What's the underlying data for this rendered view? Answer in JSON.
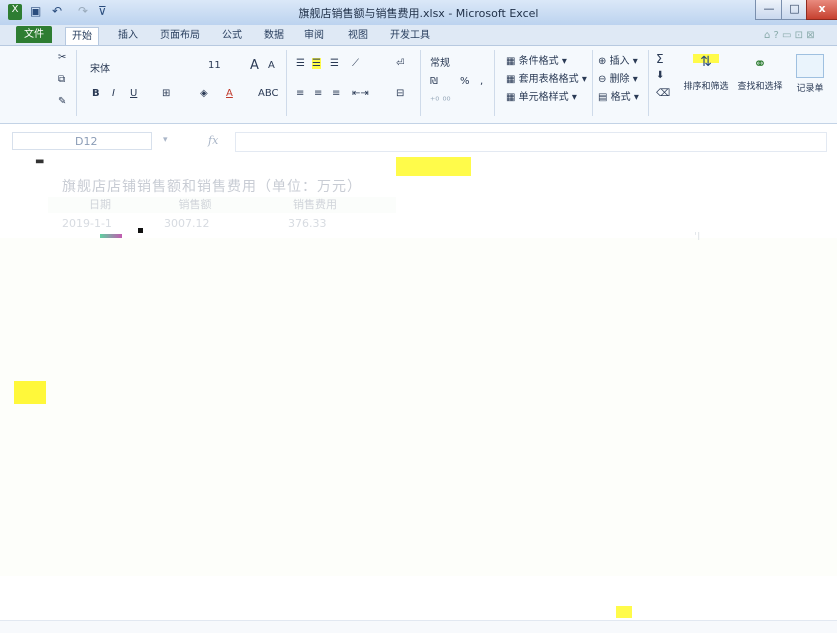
{
  "window": {
    "title": "旗舰店销售额与销售费用.xlsx - Microsoft Excel",
    "controls": {
      "minimize": "—",
      "maximize": "□",
      "close": "x"
    }
  },
  "ribbon_tabs": [
    "文件",
    "开始",
    "插入",
    "页面布局",
    "公式",
    "数据",
    "审阅",
    "视图",
    "开发工具"
  ],
  "ribbon": {
    "font_name": "宋体",
    "font_size": "11",
    "grow_font": "A",
    "shrink_font": "A",
    "bold": "B",
    "italic": "I",
    "underline": "U",
    "font_color": "A",
    "number_format": "常规",
    "percent": "%",
    "comma": ",",
    "conditional_format": "条件格式",
    "table_format": "套用表格格式",
    "cell_style": "单元格样式",
    "insert": "插入",
    "delete": "删除",
    "format": "格式",
    "sort_filter": "排序和筛选",
    "find_select": "查找和选择",
    "record_list": "记录单",
    "sum": "Σ"
  },
  "formula_bar": {
    "name_box": "D12",
    "fx": "fx"
  },
  "sheet": {
    "title": "旗舰店店铺销售额和销售费用（单位：万元）",
    "headers": [
      "日期",
      "销售额",
      "销售费用"
    ],
    "rows": [
      [
        "2019-1-1",
        "3007.12",
        "376.33"
      ]
    ]
  },
  "colors": {
    "file_tab": "#2e7d32",
    "highlight_yellow": "#fffb4a",
    "window_frame": "#bcd3ef"
  }
}
